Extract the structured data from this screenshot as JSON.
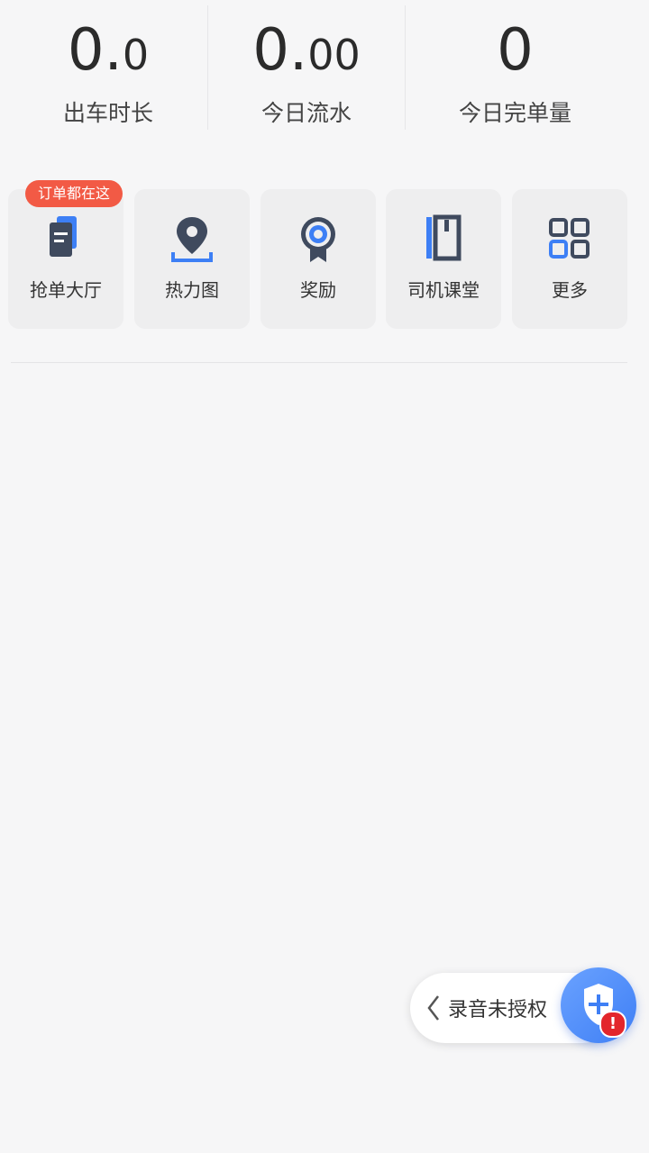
{
  "stats": [
    {
      "value_int": "0.",
      "value_dec": "0",
      "label": "出车时长"
    },
    {
      "value_int": "0.",
      "value_dec": "00",
      "label": "今日流水"
    },
    {
      "value_int": "0",
      "value_dec": "",
      "label": "今日完单量"
    }
  ],
  "quick_actions": {
    "badge": "订单都在这",
    "items": [
      {
        "label": "抢单大厅",
        "icon": "order-hall-icon"
      },
      {
        "label": "热力图",
        "icon": "location-pin-icon"
      },
      {
        "label": "奖励",
        "icon": "award-medal-icon"
      },
      {
        "label": "司机课堂",
        "icon": "book-icon"
      },
      {
        "label": "更多",
        "icon": "grid-more-icon"
      }
    ]
  },
  "recording": {
    "status_text": "录音未授权",
    "warning_mark": "!"
  },
  "colors": {
    "accent_blue": "#3d7ff5",
    "icon_dark": "#3f4a5e",
    "badge_red": "#f25a45",
    "warning_red": "#e3262b"
  }
}
